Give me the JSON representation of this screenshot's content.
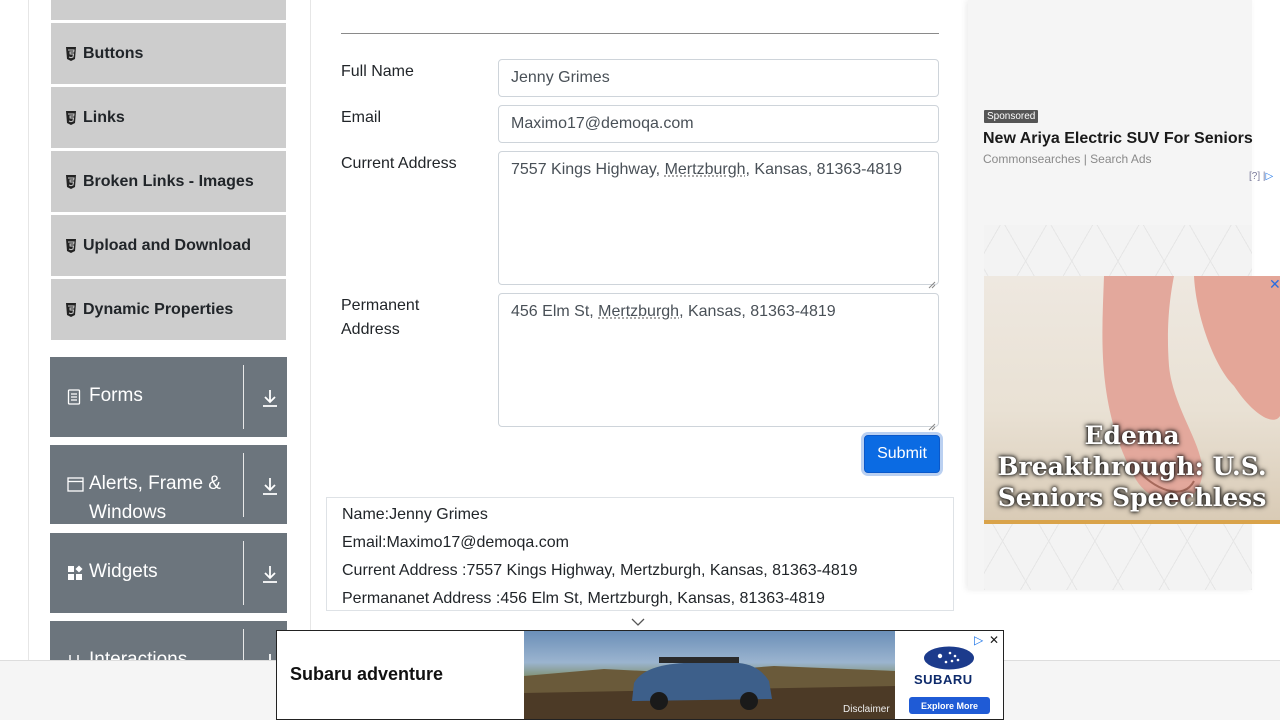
{
  "sidebar": {
    "items": [
      {
        "label": "Buttons",
        "icon": "html5-icon"
      },
      {
        "label": "Links",
        "icon": "html5-icon"
      },
      {
        "label": "Broken Links - Images",
        "icon": "html5-icon"
      },
      {
        "label": "Upload and Download",
        "icon": "html5-icon"
      },
      {
        "label": "Dynamic Properties",
        "icon": "html5-icon"
      }
    ],
    "groups": [
      {
        "label": "Forms",
        "icon": "form-icon"
      },
      {
        "label": "Alerts, Frame & Windows",
        "label_line1": "Alerts, Frame &",
        "label_line2": "Windows",
        "icon": "window-icon"
      },
      {
        "label": "Widgets",
        "icon": "widgets-icon"
      },
      {
        "label": "Interactions",
        "icon": "interactions-icon"
      }
    ]
  },
  "form": {
    "full_name": {
      "label": "Full Name",
      "value": "Jenny Grimes"
    },
    "email": {
      "label": "Email",
      "value": "Maximo17@demoqa.com"
    },
    "current_address": {
      "label": "Current Address",
      "pre": "7557 Kings Highway, ",
      "city": "Mertzburgh",
      "post": ", Kansas, 81363-4819"
    },
    "permanent_address": {
      "label_line1": "Permanent",
      "label_line2": "Address",
      "pre": "456 Elm St, ",
      "city": "Mertzburgh",
      "post": ", Kansas, 81363-4819"
    },
    "submit_label": "Submit"
  },
  "output": {
    "name": "Name:Jenny Grimes",
    "email": "Email:Maximo17@demoqa.com",
    "current_address": "Current Address :7557 Kings Highway, Mertzburgh, Kansas, 81363-4819",
    "permanent_address": "Permananet Address :456 Elm St, Mertzburgh, Kansas, 81363-4819"
  },
  "ad_right": {
    "badge": "Sponsored",
    "headline": "New Ariya Electric SUV For Seniors",
    "source": "Commonsearches | Search Ads",
    "help": "[?]",
    "image_text_line1": "Edema",
    "image_text_line2": "Breakthrough: U.S.",
    "image_text_line3": "Seniors Speechless"
  },
  "banner": {
    "title": "Subaru adventure",
    "disclaimer": "Disclaimer",
    "brand": "SUBARU",
    "cta": "Explore More"
  },
  "colors": {
    "submit": "#0b6be3",
    "sidebar_group": "#6c757d",
    "sidebar_item": "#cdcdcd"
  }
}
